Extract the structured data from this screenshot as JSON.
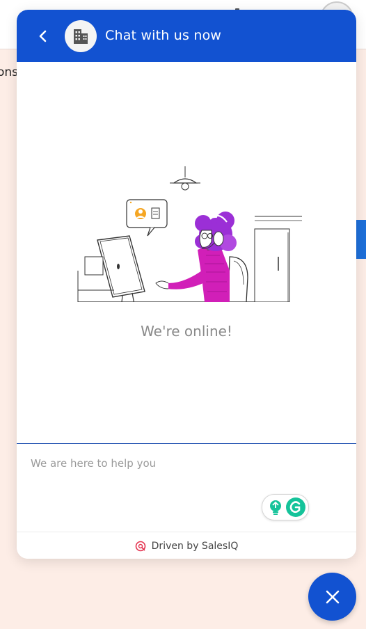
{
  "background": {
    "partial_text": "ons"
  },
  "header": {
    "title": "Chat with us now",
    "back_icon": "chevron-left-icon",
    "avatar_icon": "building-icon",
    "color": "#1252d1"
  },
  "main": {
    "status_text": "We're online!"
  },
  "composer": {
    "placeholder": "We are here to help you"
  },
  "footer": {
    "text": "Driven by SalesIQ",
    "icon": "salesiq-logo-icon"
  },
  "fab": {
    "icon": "close-icon",
    "color": "#1252d1"
  },
  "colors": {
    "page_bg": "#fdede6",
    "accent": "#1252d1",
    "illustration_purple": "#9b2fd6",
    "illustration_magenta": "#d11fb8"
  }
}
